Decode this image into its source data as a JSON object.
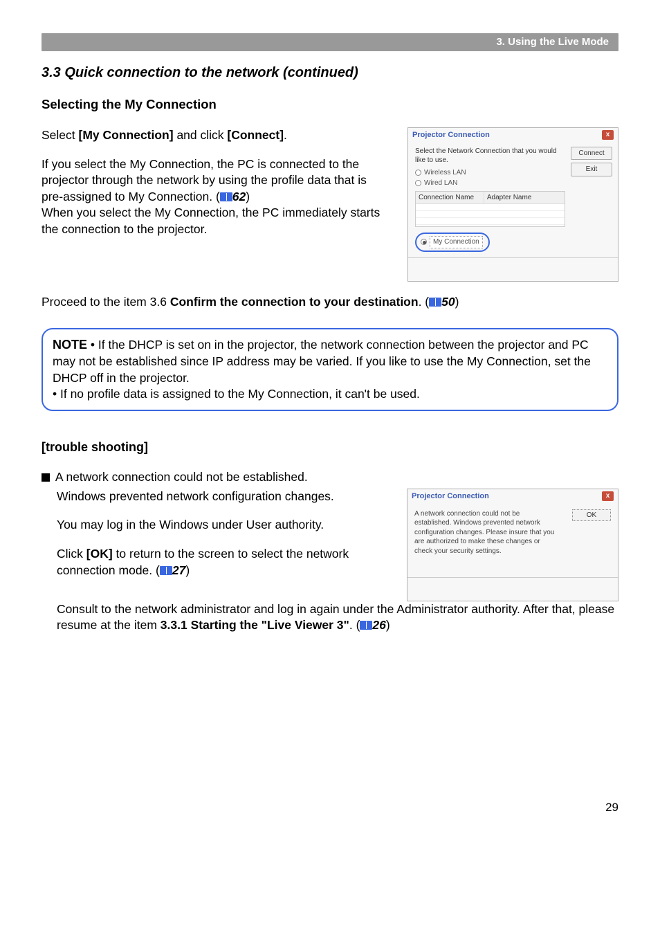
{
  "header": {
    "chapter": "3. Using the Live Mode"
  },
  "section": {
    "title": "3.3 Quick connection to the network (continued)",
    "subheading": "Selecting the My Connection"
  },
  "intro": {
    "line1_prefix": "Select ",
    "line1_bold1": "[My Connection]",
    "line1_mid": " and click ",
    "line1_bold2": "[Connect]",
    "line1_suffix": ".",
    "para2_a": "If you select the My Connection, the PC is connected to the projector through the network by using the profile data that is pre-assigned to My Connection. (",
    "para2_ref": "62",
    "para2_b": ")",
    "para2_c": "When you select the My Connection, the PC immediately starts the connection to the projector.",
    "proceed_a": "Proceed to the item 3.6 ",
    "proceed_bold": "Confirm the connection to your destination",
    "proceed_b": ". (",
    "proceed_ref": "50",
    "proceed_c": ")"
  },
  "dialog1": {
    "title": "Projector Connection",
    "instruction": "Select the Network Connection that you would like to use.",
    "radio_wireless": "Wireless LAN",
    "radio_wired": "Wired LAN",
    "col1": "Connection Name",
    "col2": "Adapter Name",
    "radio_myconn": "My Connection",
    "btn_connect": "Connect",
    "btn_exit": "Exit"
  },
  "note": {
    "label": "NOTE",
    "bullet1": " • If the DHCP is set on in the projector, the network connection between the projector and PC may not be established since IP address may be varied. If you like to use the My Connection, set the DHCP off in the projector.",
    "bullet2": "• If no profile data is assigned to the My Connection, it can't be used."
  },
  "trouble": {
    "heading": "[trouble shooting]",
    "bullet": " A network connection could not be established.",
    "p1": "Windows prevented network configuration changes.",
    "p2": "You may log in the Windows under User authority.",
    "p3_a": "Click ",
    "p3_bold": "[OK]",
    "p3_b": " to return to the screen to select the network connection mode. (",
    "p3_ref": "27",
    "p3_c": ")",
    "p4_a": "Consult to the network administrator and log in again under the Administrator authority. After that, please resume at the item ",
    "p4_bold": "3.3.1 Starting the \"Live Viewer 3\"",
    "p4_b": ". (",
    "p4_ref": "26",
    "p4_c": ")"
  },
  "dialog2": {
    "title": "Projector Connection",
    "msg": "A network connection could not be established. Windows prevented network configuration changes. Please insure that you are authorized to make these changes or check your security settings.",
    "ok": "OK"
  },
  "page_number": "29"
}
